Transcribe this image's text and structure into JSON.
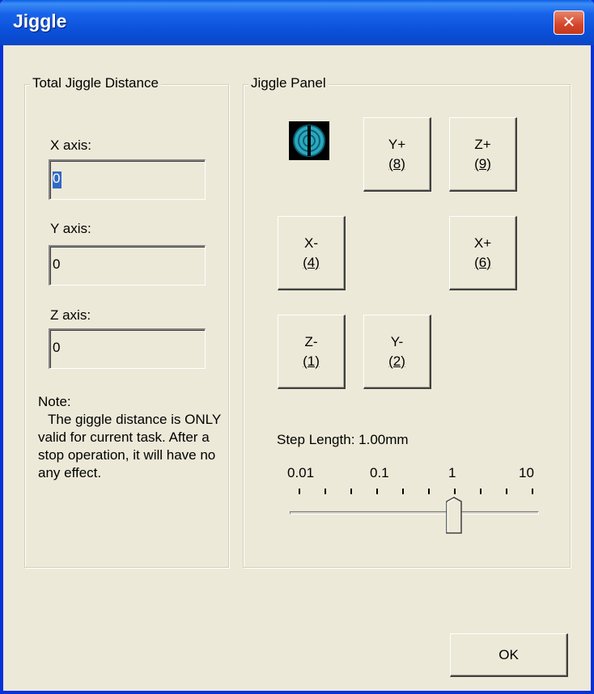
{
  "window": {
    "title": "Jiggle",
    "close_glyph": "✕"
  },
  "total_distance": {
    "group_label": "Total Jiggle Distance",
    "x_label": "X axis:",
    "x_value": "0",
    "y_label": "Y axis:",
    "y_value": "0",
    "z_label": "Z axis:",
    "z_value": "0"
  },
  "note": {
    "title": "Note:",
    "body": "The giggle distance is ONLY valid for current task. After a stop operation, it will have no any effect."
  },
  "jiggle_panel": {
    "group_label": "Jiggle Panel",
    "logo_icon": "app-logo-icon",
    "buttons": {
      "y_plus": {
        "axis": "Y+",
        "key": "(8)"
      },
      "z_plus": {
        "axis": "Z+",
        "key": "(9)"
      },
      "x_minus": {
        "axis": "X-",
        "key": "(4)"
      },
      "x_plus": {
        "axis": "X+",
        "key": "(6)"
      },
      "z_minus": {
        "axis": "Z-",
        "key": "(1)"
      },
      "y_minus": {
        "axis": "Y-",
        "key": "(2)"
      }
    },
    "step_length_label": "Step Length: 1.00mm",
    "slider": {
      "tick_labels": [
        "0.01",
        "0.1",
        "1",
        "10"
      ],
      "selected_value": "1",
      "tick_count": 10,
      "selected_tick_index": 6
    }
  },
  "footer": {
    "ok_label": "OK"
  },
  "colors": {
    "titlebar": "#0a4fd8",
    "dialog_bg": "#ece9d8",
    "selection": "#316ac5",
    "close_button": "#d5452a"
  }
}
